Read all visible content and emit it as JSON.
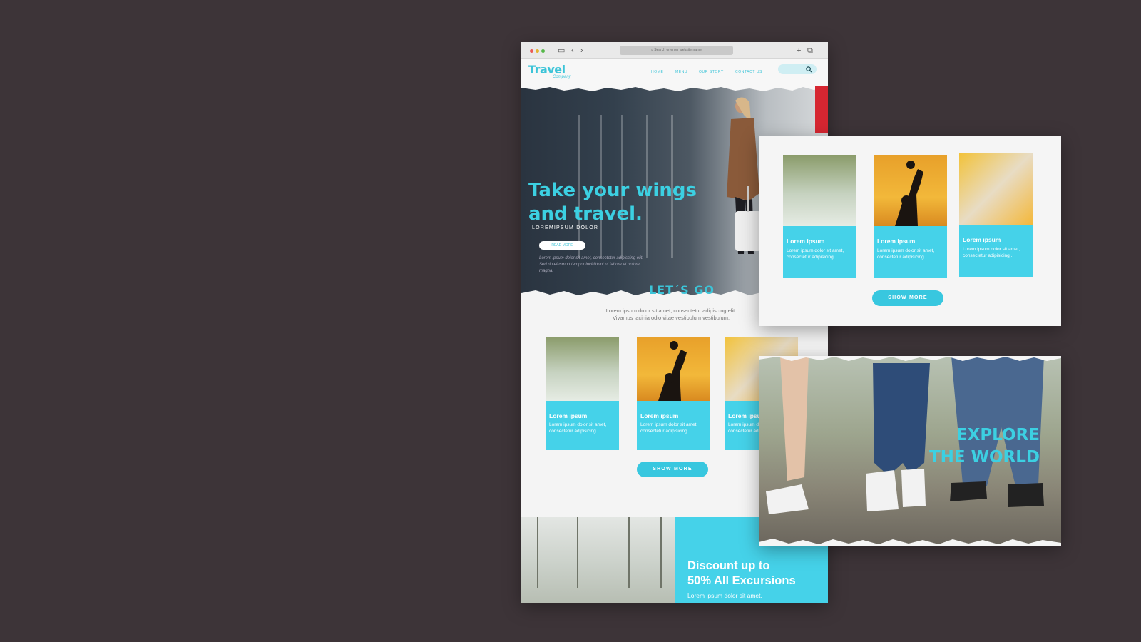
{
  "browser": {
    "url_placeholder": "Search or enter website name"
  },
  "site": {
    "logo": "Travel",
    "logo_sub": "Company",
    "nav": [
      "HOME",
      "MENU",
      "OUR STORY",
      "CONTACT US"
    ]
  },
  "hero": {
    "title_line1": "Take your wings",
    "title_line2": "and travel.",
    "subtitle": "LOREMIPSUM DOLOR",
    "button": "READ MORE",
    "body": "Lorem ipsum dolor sit amet, consectetur adipiscing elit. Sed do eiusmod tempor incididunt ut labore et dolore magna."
  },
  "letsgo": {
    "title": "LET´S GO",
    "intro_line1": "Lorem ipsum dolor sit amet, consectetur adipiscing elit.",
    "intro_line2": "Vivamus lacinia odio vitae vestibulum vestibulum."
  },
  "cards": [
    {
      "title": "Lorem ipsum",
      "text": "Lorem ipsum dolor sit amet, consectetur  adipisicing..."
    },
    {
      "title": "Lorem ipsum",
      "text": "Lorem ipsum dolor sit amet, consectetur  adipisicing..."
    },
    {
      "title": "Lorem ipsum",
      "text": "Lorem ipsum dolor sit amet, consectetur  adipisicing..."
    }
  ],
  "show_more": "SHOW MORE",
  "promo": {
    "title_line1": "Discount up to",
    "title_line2": "50% All Excursions",
    "text": "Lorem ipsum dolor sit amet,"
  },
  "explore": {
    "line1": "EXPLORE",
    "line2": "THE WORLD"
  },
  "colors": {
    "accent": "#45d2e9",
    "background": "#3d3438"
  }
}
